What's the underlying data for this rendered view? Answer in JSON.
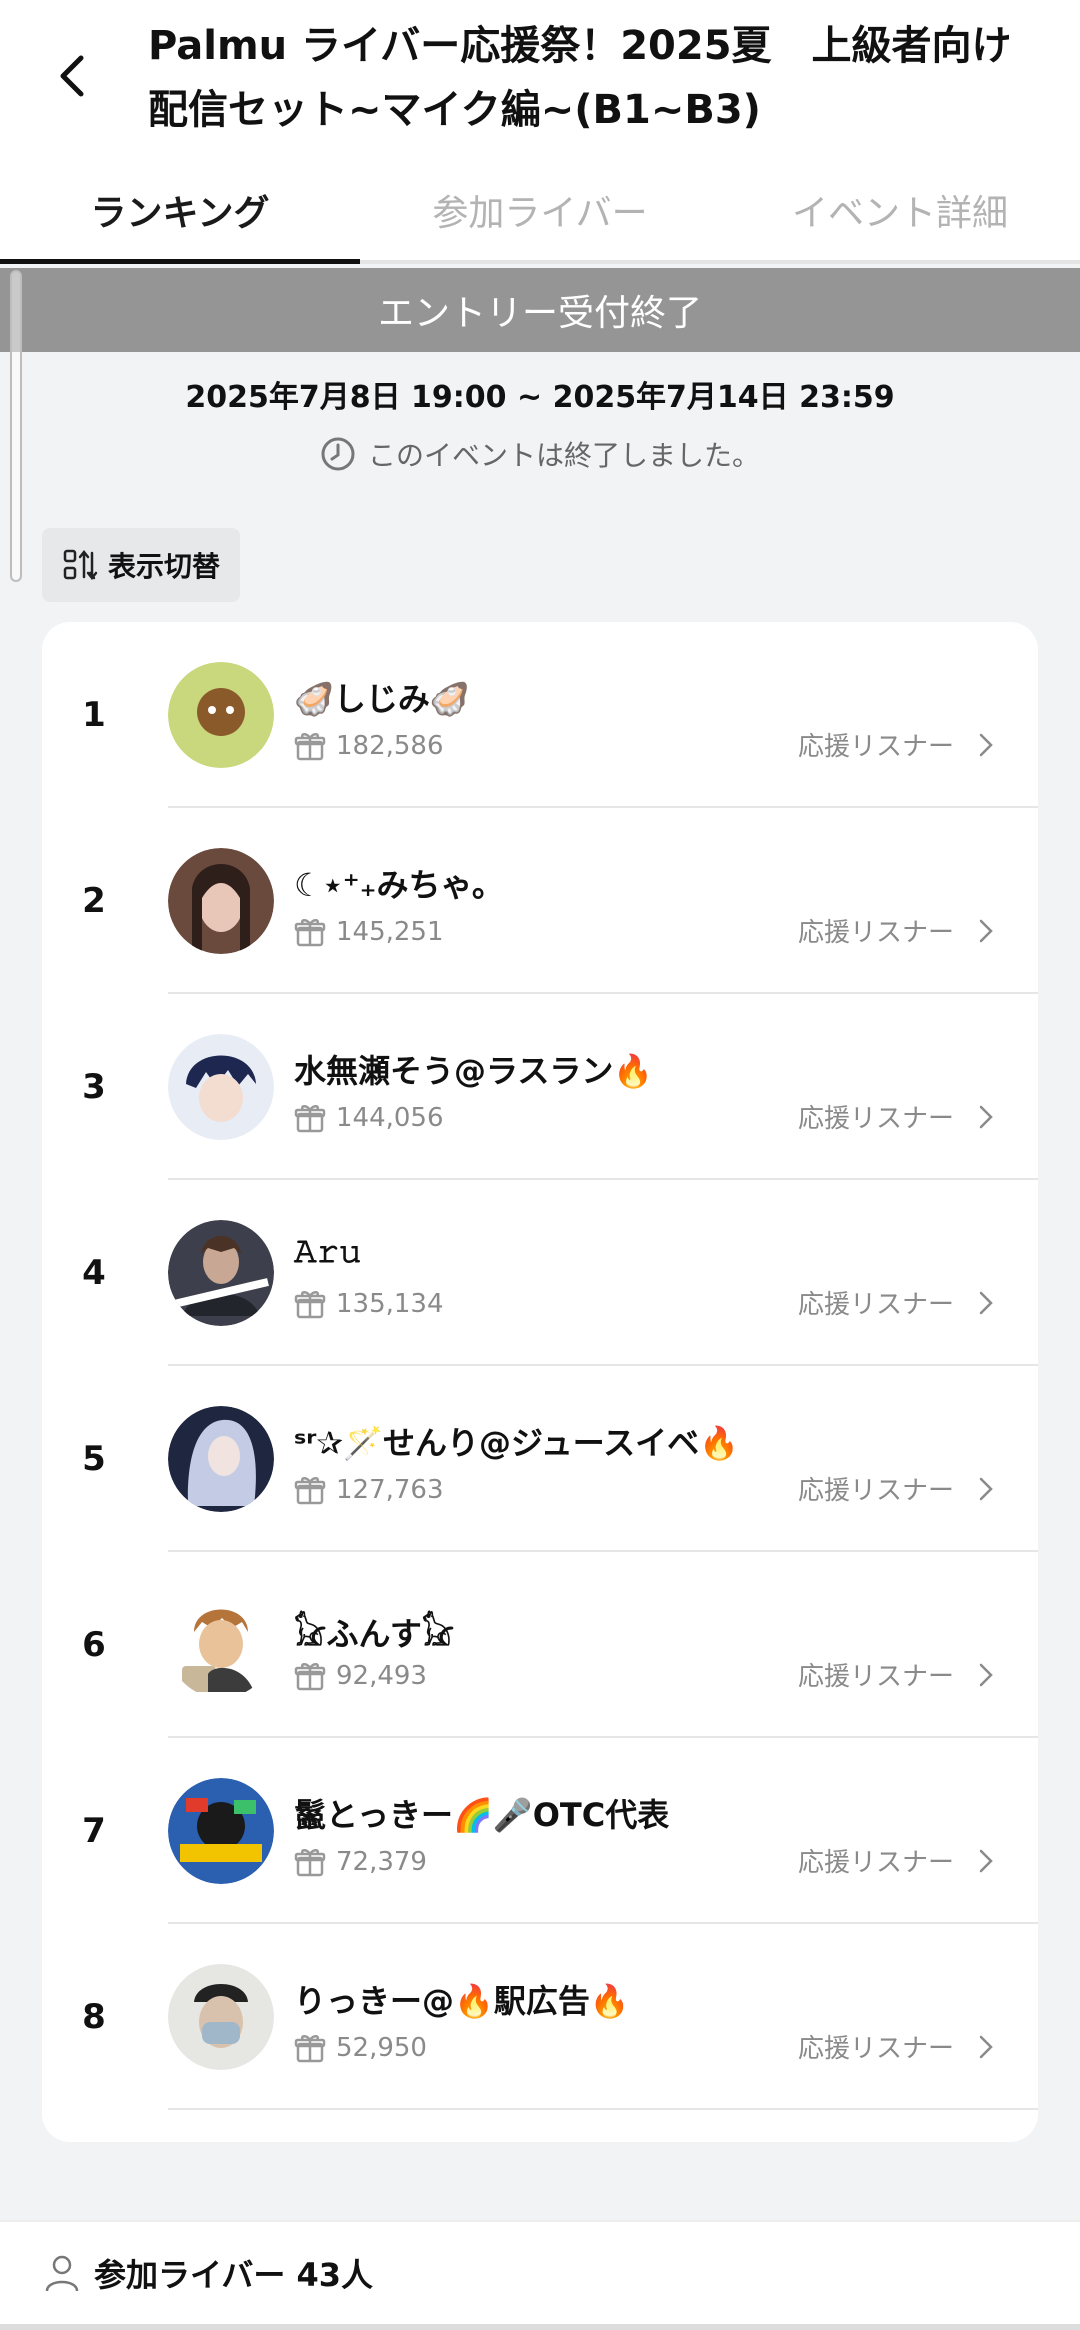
{
  "header": {
    "title": "Palmu ライバー応援祭！2025夏　上級者向け配信セット~マイク編~(B1~B3)"
  },
  "tabs": [
    {
      "label": "ランキング"
    },
    {
      "label": "参加ライバー"
    },
    {
      "label": "イベント詳細"
    }
  ],
  "entry_banner": "エントリー受付終了",
  "period": "2025年7月8日 19:00 ~ 2025年7月14日 23:59",
  "ended_text": "このイベントは終了しました。",
  "toggle_label": "表示切替",
  "listener_label": "応援リスナー",
  "ranking": [
    {
      "rank": "1",
      "name": "🦪しじみ🦪",
      "score": "182,586",
      "avatar_color": "#c9d77d"
    },
    {
      "rank": "2",
      "name": "☾⋆⁺₊みちゃ。",
      "score": "145,251",
      "avatar_color": "#6b4a3e"
    },
    {
      "rank": "3",
      "name": "水無瀬そう@ラスラン🔥",
      "score": "144,056",
      "avatar_color": "#3a4e86"
    },
    {
      "rank": "4",
      "name": "𝙰𝚛𝚞",
      "score": "135,134",
      "avatar_color": "#4a4e5c"
    },
    {
      "rank": "5",
      "name": "ˢʳ✰🪄せんり@ジュースイベ🔥",
      "score": "127,763",
      "avatar_color": "#9ba6c4"
    },
    {
      "rank": "6",
      "name": "𓃠ふんす𓃠",
      "score": "92,493",
      "avatar_color": "#c49a6c"
    },
    {
      "rank": "7",
      "name": "鬣とっきー🌈🎤OTC代表",
      "score": "72,379",
      "avatar_color": "#2b5fb0"
    },
    {
      "rank": "8",
      "name": "りっきー@🔥駅広告🔥",
      "score": "52,950",
      "avatar_color": "#b8b8b4"
    }
  ],
  "footer": {
    "participants_label": "参加ライバー 43人"
  }
}
